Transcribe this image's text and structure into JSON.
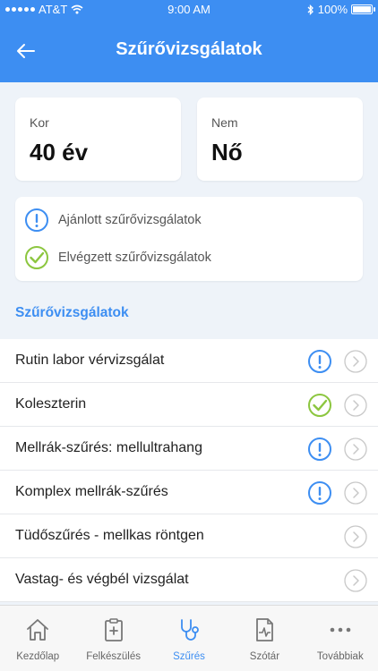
{
  "status_bar": {
    "carrier": "AT&T",
    "time": "9:00 AM",
    "battery": "100%"
  },
  "header": {
    "title": "Szűrővizsgálatok"
  },
  "age_card": {
    "label": "Kor",
    "value": "40 év"
  },
  "sex_card": {
    "label": "Nem",
    "value": "Nő"
  },
  "legend": {
    "recommended": "Ajánlott szűrővizsgálatok",
    "completed": "Elvégzett szűrővizsgálatok"
  },
  "section_title": "Szűrővizsgálatok",
  "items": [
    {
      "label": "Rutin labor vérvizsgálat",
      "status": "recommended"
    },
    {
      "label": "Koleszterin",
      "status": "completed"
    },
    {
      "label": "Mellrák-szűrés: mellultrahang",
      "status": "recommended"
    },
    {
      "label": "Komplex mellrák-szűrés",
      "status": "recommended"
    },
    {
      "label": "Tüdőszűrés - mellkas röntgen",
      "status": "none"
    },
    {
      "label": "Vastag- és végbél vizsgálat",
      "status": "none"
    }
  ],
  "tabs": [
    {
      "label": "Kezdőlap",
      "icon": "home-icon"
    },
    {
      "label": "Felkészülés",
      "icon": "clipboard-icon"
    },
    {
      "label": "Szűrés",
      "icon": "stethoscope-icon"
    },
    {
      "label": "Szótár",
      "icon": "dictionary-icon"
    },
    {
      "label": "Továbbiak",
      "icon": "more-icon"
    }
  ],
  "colors": {
    "primary": "#3d8ef2",
    "recommended": "#3d8ef2",
    "completed": "#8cc63f"
  }
}
